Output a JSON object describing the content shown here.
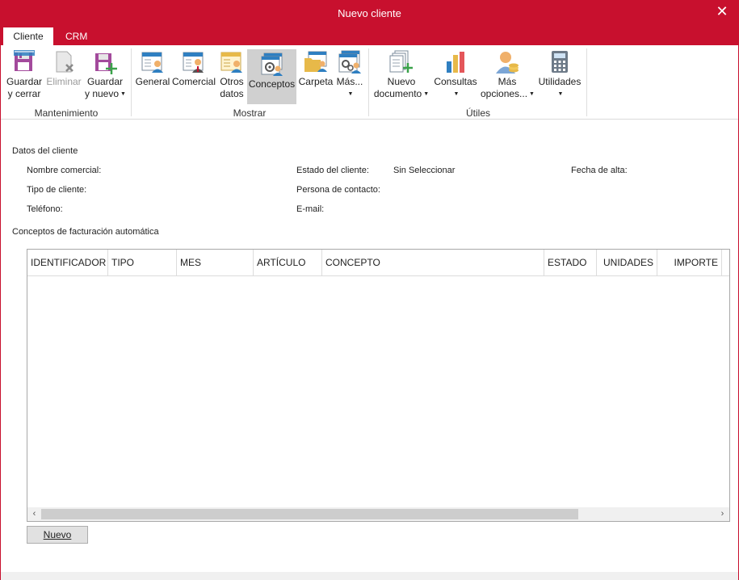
{
  "window": {
    "title": "Nuevo cliente",
    "close_glyph": "✕"
  },
  "tabs": [
    {
      "label": "Cliente"
    },
    {
      "label": "CRM"
    }
  ],
  "ribbon": {
    "mantenimiento": {
      "label": "Mantenimiento",
      "guardar_cerrar": {
        "line1": "Guardar",
        "line2": "y cerrar",
        "icon": "save-close-icon"
      },
      "eliminar": {
        "line1": "Eliminar",
        "icon": "delete-icon"
      },
      "guardar_nuevo": {
        "line1": "Guardar",
        "line2": "y nuevo",
        "icon": "save-new-icon"
      }
    },
    "mostrar": {
      "label": "Mostrar",
      "general": {
        "line1": "General",
        "icon": "general-card-icon"
      },
      "comercial": {
        "line1": "Comercial",
        "icon": "commercial-card-icon"
      },
      "otros_datos": {
        "line1": "Otros",
        "line2": "datos",
        "icon": "other-data-icon"
      },
      "conceptos": {
        "line1": "Conceptos",
        "icon": "concepts-icon"
      },
      "carpeta": {
        "line1": "Carpeta",
        "icon": "folder-icon"
      },
      "mas": {
        "line1": "Más...",
        "icon": "more-icon"
      }
    },
    "utiles": {
      "label": "Útiles",
      "nuevo_documento": {
        "line1": "Nuevo",
        "line2": "documento",
        "icon": "new-document-icon"
      },
      "consultas": {
        "line1": "Consultas",
        "icon": "bar-chart-icon"
      },
      "mas_opciones": {
        "line1": "Más",
        "line2": "opciones...",
        "icon": "person-coins-icon"
      },
      "utilidades": {
        "line1": "Utilidades",
        "icon": "calculator-icon"
      }
    }
  },
  "datos": {
    "section_title": "Datos del cliente",
    "nombre_comercial": "Nombre comercial:",
    "estado_cliente": "Estado del cliente:",
    "estado_valor": "Sin Seleccionar",
    "fecha_alta": "Fecha de alta:",
    "tipo_cliente": "Tipo de cliente:",
    "persona_contacto": "Persona de contacto:",
    "telefono": "Teléfono:",
    "email": "E-mail:"
  },
  "conceptos": {
    "section_title": "Conceptos de facturación automática",
    "columns": [
      "IDENTIFICADOR",
      "TIPO",
      "MES",
      "ARTÍCULO",
      "CONCEPTO",
      "ESTADO",
      "UNIDADES",
      "IMPORTE"
    ],
    "nuevo_button": "Nuevo"
  },
  "colors": {
    "accent": "#c8102e",
    "selected_button": "#d0d0d0"
  }
}
